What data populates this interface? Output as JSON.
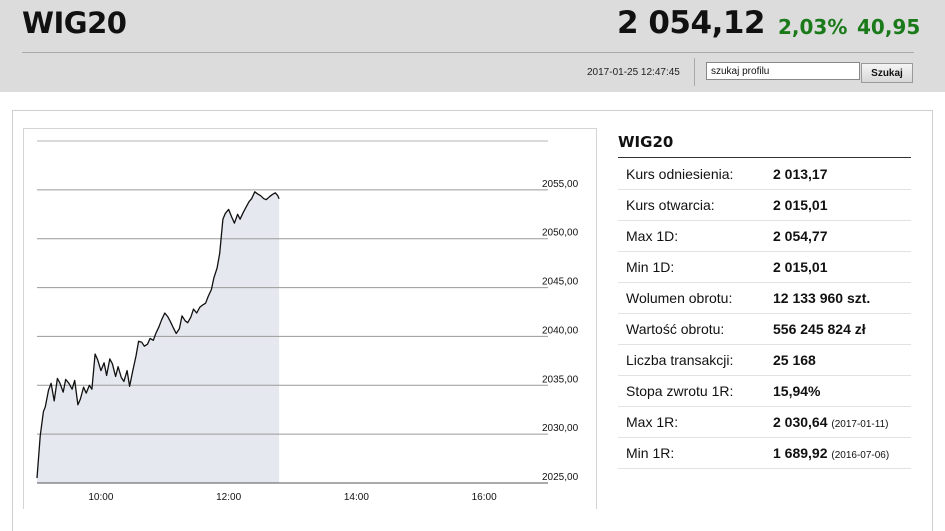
{
  "header": {
    "title": "WIG20",
    "price": "2 054,12",
    "change_pct": "2,03%",
    "change_abs": "40,95",
    "datetime": "2017-01-25 12:47:45",
    "change_color": "#1a7a1a"
  },
  "search": {
    "value": "szukaj profilu",
    "button_label": "Szukaj"
  },
  "info": {
    "title": "WIG20",
    "rows": [
      {
        "label": "Kurs odniesienia:",
        "value": "2 013,17",
        "note": ""
      },
      {
        "label": "Kurs otwarcia:",
        "value": "2 015,01",
        "note": ""
      },
      {
        "label": "Max 1D:",
        "value": "2 054,77",
        "note": ""
      },
      {
        "label": "Min 1D:",
        "value": "2 015,01",
        "note": ""
      },
      {
        "label": "Wolumen obrotu:",
        "value": "12 133 960 szt.",
        "note": ""
      },
      {
        "label": "Wartość obrotu:",
        "value": "556 245 824 zł",
        "note": ""
      },
      {
        "label": "Liczba transakcji:",
        "value": "25 168",
        "note": ""
      },
      {
        "label": "Stopa zwrotu 1R:",
        "value": "15,94%",
        "note": ""
      },
      {
        "label": "Max 1R:",
        "value": "2 030,64",
        "note": "(2017-01-11)"
      },
      {
        "label": "Min 1R:",
        "value": "1 689,92",
        "note": "(2016-07-06)"
      }
    ]
  },
  "chart_data": {
    "type": "area",
    "x_unit": "time of day (hours)",
    "xlim": [
      9.0,
      17.0
    ],
    "ylim": [
      2025.0,
      2060.0
    ],
    "y_ticks": [
      2025,
      2030,
      2035,
      2040,
      2045,
      2050,
      2055
    ],
    "y_tick_labels": [
      "2025,00",
      "2030,00",
      "2035,00",
      "2040,00",
      "2045,00",
      "2050,00",
      "2055,00"
    ],
    "x_ticks": [
      10,
      12,
      14,
      16
    ],
    "x_tick_labels": [
      "10:00",
      "12:00",
      "14:00",
      "16:00"
    ],
    "grid": true,
    "line_color": "#111111",
    "fill_color": "#e5e8ef",
    "x": [
      9.0,
      9.05,
      9.1,
      9.13,
      9.18,
      9.22,
      9.27,
      9.32,
      9.36,
      9.41,
      9.45,
      9.5,
      9.55,
      9.59,
      9.64,
      9.68,
      9.73,
      9.77,
      9.82,
      9.86,
      9.91,
      9.95,
      10.0,
      10.05,
      10.09,
      10.14,
      10.18,
      10.23,
      10.27,
      10.32,
      10.36,
      10.41,
      10.45,
      10.5,
      10.55,
      10.59,
      10.64,
      10.68,
      10.73,
      10.77,
      10.82,
      10.86,
      10.91,
      10.95,
      11.0,
      11.05,
      11.09,
      11.14,
      11.18,
      11.23,
      11.27,
      11.32,
      11.36,
      11.41,
      11.45,
      11.5,
      11.55,
      11.59,
      11.64,
      11.68,
      11.73,
      11.77,
      11.82,
      11.86,
      11.91,
      11.95,
      12.0,
      12.05,
      12.09,
      12.14,
      12.18,
      12.23,
      12.27,
      12.32,
      12.36,
      12.41,
      12.45,
      12.5,
      12.55,
      12.59,
      12.64,
      12.68,
      12.73,
      12.77,
      12.79
    ],
    "values": [
      2025.5,
      2029.8,
      2032.3,
      2032.8,
      2034.5,
      2035.2,
      2033.4,
      2035.7,
      2035.2,
      2034.3,
      2035.6,
      2035.2,
      2034.6,
      2035.5,
      2033.0,
      2033.6,
      2034.8,
      2034.2,
      2035.0,
      2034.6,
      2038.2,
      2037.6,
      2036.5,
      2037.3,
      2036.0,
      2037.7,
      2037.2,
      2035.9,
      2036.9,
      2035.8,
      2035.4,
      2036.5,
      2034.9,
      2036.5,
      2038.0,
      2039.5,
      2039.4,
      2039.0,
      2039.2,
      2039.8,
      2039.6,
      2040.3,
      2041.0,
      2041.7,
      2042.4,
      2042.0,
      2041.5,
      2040.8,
      2040.3,
      2040.8,
      2042.1,
      2041.6,
      2041.4,
      2042.0,
      2042.8,
      2042.4,
      2043.0,
      2043.2,
      2043.4,
      2044.1,
      2044.8,
      2046.0,
      2047.0,
      2048.5,
      2052.0,
      2052.6,
      2053.0,
      2052.2,
      2051.6,
      2052.5,
      2052.0,
      2052.7,
      2053.2,
      2053.8,
      2054.1,
      2054.8,
      2054.6,
      2054.4,
      2054.1,
      2054.0,
      2054.3,
      2054.5,
      2054.7,
      2054.4,
      2054.1
    ]
  }
}
